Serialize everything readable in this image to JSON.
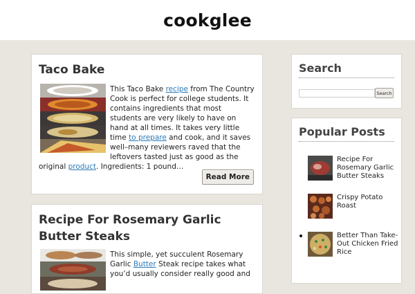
{
  "site": {
    "title": "cookglee"
  },
  "posts": [
    {
      "title": "Taco Bake",
      "excerpt": {
        "t1": "This Taco Bake ",
        "l1": "recipe",
        "t2": " from The Country Cook is perfect for college students. It contains ingredients that most students are very likely to have on hand at all times. It takes very little time ",
        "l2": "to prepare",
        "t3": " and cook, and it saves well–many reviewers raved that the leftovers tasted just as good as the original ",
        "l3": "product",
        "t4": ". Ingredients: 1 pound…"
      },
      "read_more": "Read More"
    },
    {
      "title": "Recipe For Rosemary Garlic Butter Steaks",
      "excerpt": {
        "t1": "This simple, yet succulent Rosemary Garlic ",
        "l1": "Butter",
        "t2": " Steak recipe takes what you’d usually consider really good and"
      }
    }
  ],
  "sidebar": {
    "search": {
      "title": "Search",
      "placeholder": "",
      "button": "Search"
    },
    "popular": {
      "title": "Popular Posts",
      "items": [
        {
          "label": "Recipe For Rosemary Garlic Butter Steaks"
        },
        {
          "label": "Crispy Potato Roast"
        },
        {
          "label": "Better Than Take-Out Chicken Fried Rice"
        }
      ]
    }
  },
  "colors": {
    "page_bg": "#e9e6df",
    "link": "#2a7ab8"
  }
}
